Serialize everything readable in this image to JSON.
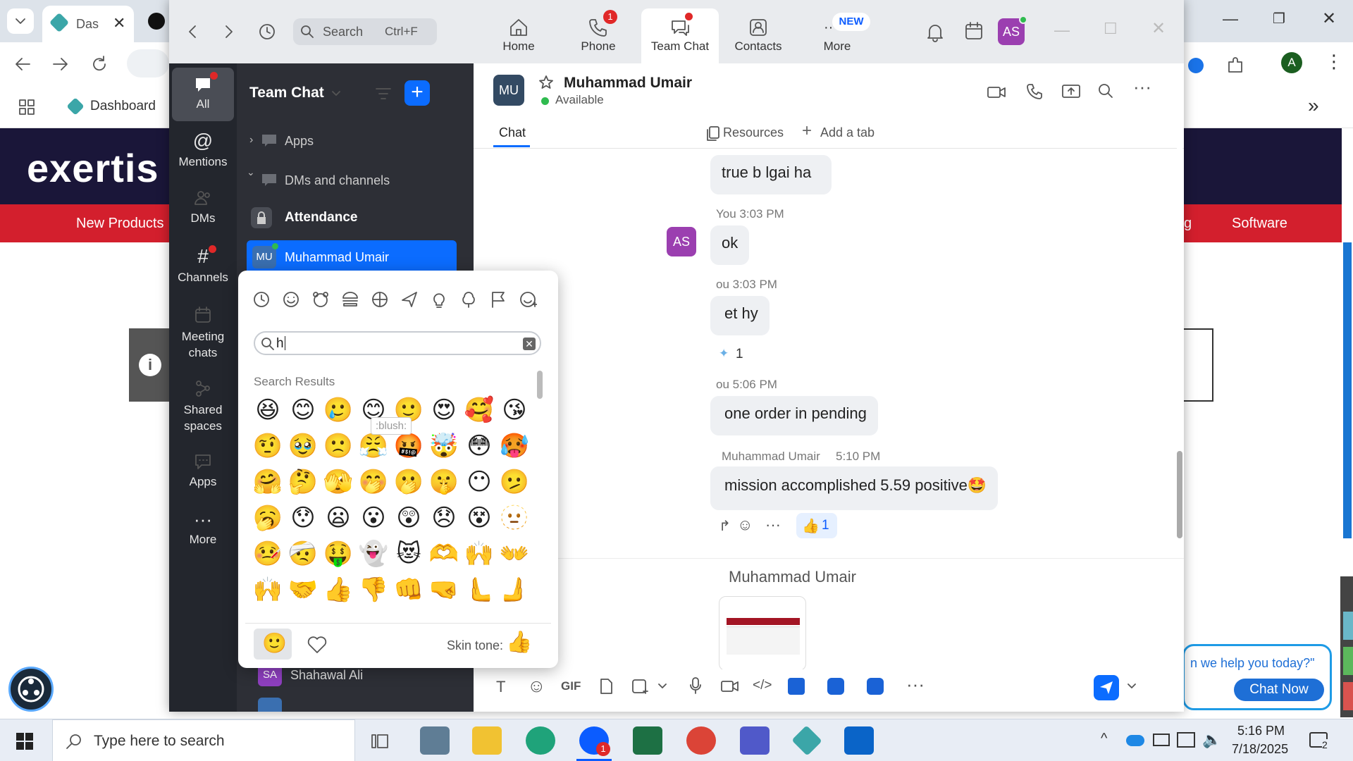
{
  "browser": {
    "tab_title": "Das",
    "bookmark_dashboard": "Dashboard",
    "profile_initial": "A"
  },
  "site": {
    "logo": "exertis",
    "nav_new_products": "New Products",
    "nav_partial": "g",
    "nav_software": "Software",
    "chat_prompt": "n we help you today?\"",
    "chat_now": "Chat Now"
  },
  "zoom": {
    "search_placeholder": "Search",
    "search_shortcut": "Ctrl+F",
    "tabs": [
      {
        "label": "Home"
      },
      {
        "label": "Phone",
        "badge": "1"
      },
      {
        "label": "Team Chat"
      },
      {
        "label": "Contacts"
      },
      {
        "label": "More",
        "badge": "NEW"
      }
    ],
    "user_initials": "AS"
  },
  "rail": {
    "items": [
      {
        "label": "All"
      },
      {
        "label": "Mentions"
      },
      {
        "label": "DMs"
      },
      {
        "label": "Channels"
      },
      {
        "label": "Meeting chats"
      },
      {
        "label": "Shared spaces"
      },
      {
        "label": "Apps"
      },
      {
        "label": "More"
      }
    ]
  },
  "chanlist": {
    "title": "Team Chat",
    "apps": "Apps",
    "dms_channels": "DMs and channels",
    "attendance": "Attendance",
    "active_dm_initials": "MU",
    "active_dm": "Muhammad Umair",
    "bottom_initials": "SA",
    "bottom_dm": "Shahawal Ali"
  },
  "chat": {
    "contact_initials": "MU",
    "contact_name": "Muhammad Umair",
    "status": "Available",
    "tab_chat": "Chat",
    "tab_resources": "Resources",
    "tab_add": "Add a tab",
    "messages": {
      "m1": "true b lgai ha",
      "m2_meta": "You 3:03 PM",
      "m2_avatar": "AS",
      "m2": "ok",
      "m3_meta": "ou 3:03 PM",
      "m3": "et hy",
      "m3_reaction": "1",
      "m4_meta": "ou 5:06 PM",
      "m4": "one order in pending",
      "m5_meta_name": "Muhammad Umair",
      "m5_meta_time": "5:10 PM",
      "m5": "mission accomplished 5.59 positive🤩",
      "m5_reaction": "1",
      "m6_name": "Muhammad Umair"
    }
  },
  "picker": {
    "search_value": "h",
    "results_label": "Search Results",
    "tooltip": ":blush:",
    "skin_tone_label": "Skin tone:",
    "emojis": [
      "😆",
      "😊",
      "🥲",
      "😊",
      "🙂",
      "😍",
      "🥰",
      "😘",
      "🤨",
      "🥹",
      "🙁",
      "😤",
      "🤬",
      "🤯",
      "😳",
      "🥵",
      "🤗",
      "🤔",
      "🫣",
      "🤭",
      "🫢",
      "🤫",
      "😶",
      "🫤",
      "🥱",
      "😯",
      "😦",
      "😮",
      "😲",
      "😞",
      "😵",
      "🫥",
      "🤒",
      "🤕",
      "🤑",
      "👻",
      "😻",
      "🫶",
      "🙌",
      "👐",
      "🙌",
      "🤝",
      "👍",
      "👎",
      "👊",
      "🤜",
      "🫷",
      "🫸"
    ]
  },
  "taskbar": {
    "search_placeholder": "Type here to search",
    "time": "5:16 PM",
    "date": "7/18/2025",
    "zoom_badge": "1",
    "notif_count": "2"
  }
}
